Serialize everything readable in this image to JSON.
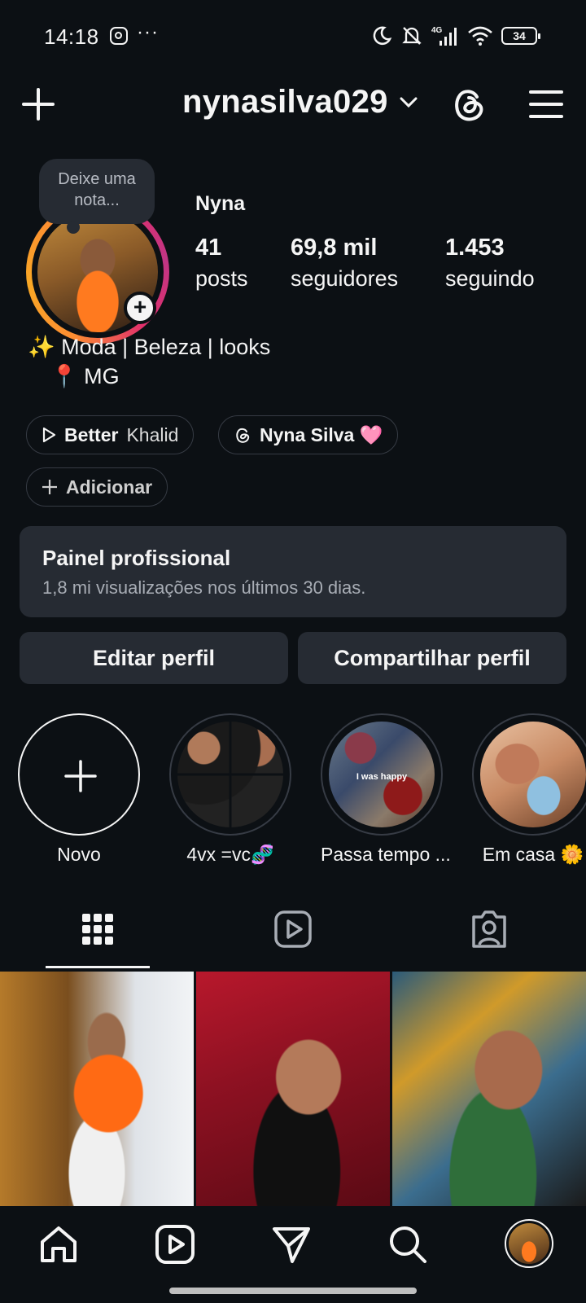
{
  "status_bar": {
    "time": "14:18",
    "network": "4G",
    "battery": "34"
  },
  "header": {
    "username": "nynasilva029"
  },
  "profile": {
    "note_placeholder": "Deixe uma nota...",
    "name": "Nyna",
    "stats": [
      {
        "value": "41",
        "label": "posts"
      },
      {
        "value": "69,8 mil",
        "label": "seguidores"
      },
      {
        "value": "1.453",
        "label": "seguindo"
      }
    ],
    "bio_line1": "✨ Moda | Beleza | looks",
    "bio_line2": "📍 MG"
  },
  "chips": {
    "music_title": "Better",
    "music_artist": "Khalid",
    "threads_name": "Nyna Silva 🩷",
    "add_label": "Adicionar"
  },
  "panel": {
    "title": "Painel profissional",
    "subtitle": "1,8 mi visualizações nos últimos 30 dias."
  },
  "buttons": {
    "edit": "Editar perfil",
    "share": "Compartilhar perfil"
  },
  "highlights": [
    {
      "label": "Novo"
    },
    {
      "label": "4vx =vc🧬"
    },
    {
      "label": "Passa tempo ..."
    },
    {
      "label": "Em casa 🌼"
    }
  ],
  "highlight_overlay_text": "I was happy",
  "tabs": {
    "active": "grid"
  },
  "colors": {
    "background": "#0c1014",
    "surface": "#262b33",
    "text": "#f5f5f5",
    "muted": "#a8adb5"
  }
}
